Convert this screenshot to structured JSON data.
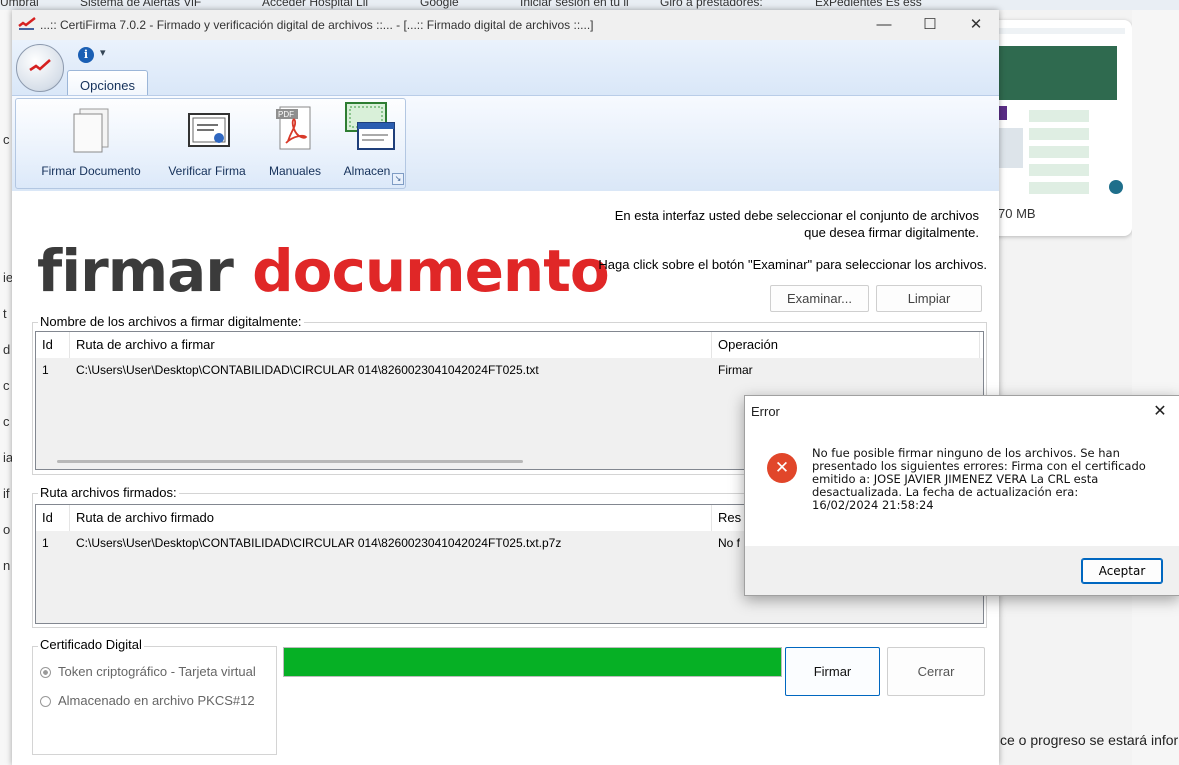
{
  "background": {
    "top_bar_items": [
      "Umbral",
      "Sistema de Alertas ViF",
      "Acceder Hospital Lll",
      "Google",
      "Iniciar sesión en tu il",
      "Giro a prestadores:",
      "ExPedientes Es ess"
    ],
    "left_letters": [
      "c",
      "ie",
      "t",
      "d",
      "c",
      "c",
      "ia",
      "if",
      "o",
      "n"
    ],
    "card_size_text": "70 MB",
    "right_text": "ce o progreso se estará infor"
  },
  "window": {
    "title": "...:: CertiFirma 7.0.2 - Firmado y verificación digital de archivos ::... - [...:: Firmado digital de archivos ::...]",
    "minimize": "—",
    "maximize": "☐",
    "close": "✕"
  },
  "ribbon": {
    "tab_label": "Opciones",
    "qat_info": "i",
    "qat_dropdown": "▾",
    "buttons": [
      {
        "label": "Firmar Documento"
      },
      {
        "label": "Verificar Firma"
      },
      {
        "label": "Manuales"
      },
      {
        "label": "Almacen"
      }
    ],
    "pdf_icon_text": "PDF"
  },
  "content": {
    "title_word1": "firmar",
    "title_word2": "documento",
    "info_line1": "En esta interfaz usted debe seleccionar el conjunto de archivos",
    "info_line2": "que  desea firmar digitalmente.",
    "info_line3": "Haga click sobre el botón \"Examinar\" para seleccionar los archivos.",
    "examinar_label": "Examinar...",
    "limpiar_label": "Limpiar",
    "files_group_caption": "Nombre de los archivos a firmar digitalmente:",
    "files_columns": [
      "Id",
      "Ruta de archivo a firmar",
      "Operación"
    ],
    "files_rows": [
      {
        "id": "1",
        "path": "C:\\Users\\User\\Desktop\\CONTABILIDAD\\CIRCULAR 014\\8260023041042024FT025.txt",
        "op": "Firmar"
      }
    ],
    "signed_group_caption": "Ruta archivos firmados:",
    "signed_columns": [
      "Id",
      "Ruta de archivo firmado",
      "Res"
    ],
    "signed_rows": [
      {
        "id": "1",
        "path": "C:\\Users\\User\\Desktop\\CONTABILIDAD\\CIRCULAR 014\\8260023041042024FT025.txt.p7z",
        "result": "No f"
      }
    ],
    "cert_group_caption": "Certificado Digital",
    "radio_token": "Token criptográfico - Tarjeta virtual",
    "radio_pkcs": "Almacenado en archivo PKCS#12",
    "progress_fraction": 1.0,
    "firmar_label": "Firmar",
    "cerrar_label": "Cerrar"
  },
  "error_dialog": {
    "title": "Error",
    "close": "✕",
    "icon": "✕",
    "message": "No fue posible firmar ninguno de los archivos. Se han presentado los siguientes errores: Firma con el certificado emitido a: JOSE JAVIER JIMENEZ VERA La CRL esta desactualizada. La fecha de actualización era: 16/02/2024 21:58:24",
    "ok_label": "Aceptar"
  },
  "colors": {
    "title_dark": "#3b3b3b",
    "title_red": "#e02727",
    "progress_green": "#06b025",
    "error_red": "#e1462a",
    "accent_blue": "#0067c0"
  }
}
